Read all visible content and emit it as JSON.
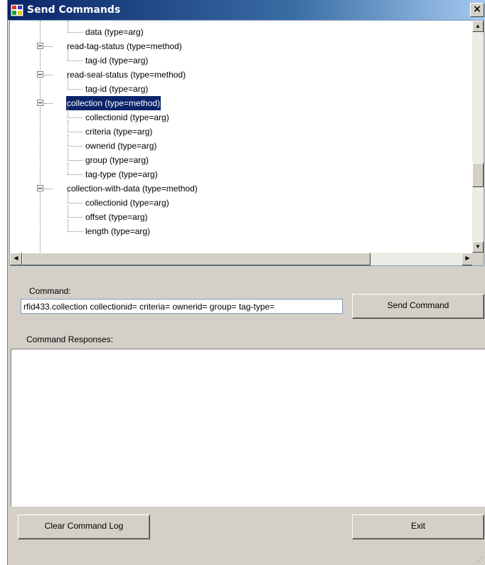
{
  "window": {
    "title": "Send Commands",
    "close_label": "×"
  },
  "tree": {
    "nodes": [
      {
        "label": "data (type=arg)",
        "level": 2,
        "expandable": false,
        "selected": false
      },
      {
        "label": "read-tag-status (type=method)",
        "level": 1,
        "expandable": true,
        "selected": false
      },
      {
        "label": "tag-id (type=arg)",
        "level": 2,
        "expandable": false,
        "selected": false
      },
      {
        "label": "read-seal-status (type=method)",
        "level": 1,
        "expandable": true,
        "selected": false
      },
      {
        "label": "tag-id (type=arg)",
        "level": 2,
        "expandable": false,
        "selected": false
      },
      {
        "label": "collection (type=method)",
        "level": 1,
        "expandable": true,
        "selected": true
      },
      {
        "label": "collectionid (type=arg)",
        "level": 2,
        "expandable": false,
        "selected": false
      },
      {
        "label": "criteria (type=arg)",
        "level": 2,
        "expandable": false,
        "selected": false
      },
      {
        "label": "ownerid (type=arg)",
        "level": 2,
        "expandable": false,
        "selected": false
      },
      {
        "label": "group (type=arg)",
        "level": 2,
        "expandable": false,
        "selected": false
      },
      {
        "label": "tag-type (type=arg)",
        "level": 2,
        "expandable": false,
        "selected": false
      },
      {
        "label": "collection-with-data (type=method)",
        "level": 1,
        "expandable": true,
        "selected": false
      },
      {
        "label": "collectionid (type=arg)",
        "level": 2,
        "expandable": false,
        "selected": false
      },
      {
        "label": "offset (type=arg)",
        "level": 2,
        "expandable": false,
        "selected": false
      },
      {
        "label": "length (type=arg)",
        "level": 2,
        "expandable": false,
        "selected": false
      }
    ]
  },
  "command": {
    "label": "Command:",
    "value": "rfid433.collection collectionid= criteria= ownerid= group= tag-type=",
    "send_label": "Send Command"
  },
  "responses": {
    "label": "Command Responses:"
  },
  "footer": {
    "clear_label": "Clear Command  Log",
    "exit_label": "Exit"
  },
  "colors": {
    "selection": "#0a246a",
    "window_bg": "#d4d0c8",
    "title_start": "#0a246a",
    "title_end": "#a6caf0"
  }
}
